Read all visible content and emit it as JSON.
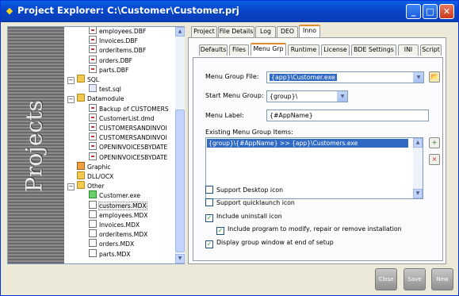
{
  "window": {
    "title": "Project Explorer: C:\\Customer\\Customer.prj",
    "minimize": "_",
    "maximize": "□",
    "close": "✕"
  },
  "banner": {
    "text": "Projects"
  },
  "tree": [
    {
      "label": "employees.DBF",
      "icon": "dbf-file-icon",
      "indent": 2
    },
    {
      "label": "Invoices.DBF",
      "icon": "dbf-file-icon",
      "indent": 2
    },
    {
      "label": "orderitems.DBF",
      "icon": "dbf-file-icon",
      "indent": 2
    },
    {
      "label": "orders.DBF",
      "icon": "dbf-file-icon",
      "indent": 2
    },
    {
      "label": "parts.DBF",
      "icon": "dbf-file-icon",
      "indent": 2
    },
    {
      "label": "SQL",
      "icon": "folder-icon",
      "indent": 1,
      "expander": "−"
    },
    {
      "label": "test.sql",
      "icon": "sql-file-icon",
      "indent": 2
    },
    {
      "label": "Datamodule",
      "icon": "folder-icon",
      "indent": 1,
      "expander": "−"
    },
    {
      "label": "Backup of CUSTOMERS",
      "icon": "datamodule-file-icon",
      "indent": 2
    },
    {
      "label": "CustomerList.dmd",
      "icon": "datamodule-file-icon",
      "indent": 2
    },
    {
      "label": "CUSTOMERSANDINVOI",
      "icon": "datamodule-file-icon",
      "indent": 2
    },
    {
      "label": "CUSTOMERSANDINVOI",
      "icon": "datamodule-file-icon",
      "indent": 2
    },
    {
      "label": "OPENINVOICESBYDATE",
      "icon": "datamodule-file-icon",
      "indent": 2
    },
    {
      "label": "OPENINVOICESBYDATE",
      "icon": "datamodule-file-icon",
      "indent": 2
    },
    {
      "label": "Graphic",
      "icon": "graphic-folder-icon",
      "indent": 1
    },
    {
      "label": "DLL/OCX",
      "icon": "folder-icon",
      "indent": 1
    },
    {
      "label": "Other",
      "icon": "folder-icon",
      "indent": 1,
      "expander": "−"
    },
    {
      "label": "Customer.exe",
      "icon": "exe-file-icon",
      "indent": 2
    },
    {
      "label": "customers.MDX",
      "icon": "mdx-file-icon",
      "indent": 2,
      "selected": true
    },
    {
      "label": "employees.MDX",
      "icon": "mdx-file-icon",
      "indent": 2
    },
    {
      "label": "Invoices.MDX",
      "icon": "mdx-file-icon",
      "indent": 2
    },
    {
      "label": "orderitems.MDX",
      "icon": "mdx-file-icon",
      "indent": 2
    },
    {
      "label": "orders.MDX",
      "icon": "mdx-file-icon",
      "indent": 2
    },
    {
      "label": "parts.MDX",
      "icon": "mdx-file-icon",
      "indent": 2
    }
  ],
  "top_tabs": [
    {
      "label": "Project"
    },
    {
      "label": "File Details"
    },
    {
      "label": "Log"
    },
    {
      "label": "DEO"
    },
    {
      "label": "Inno",
      "active": true
    }
  ],
  "sub_tabs": [
    {
      "label": "Defaults"
    },
    {
      "label": "Files"
    },
    {
      "label": "Menu Grp",
      "active": true
    },
    {
      "label": "Runtime"
    },
    {
      "label": "License"
    },
    {
      "label": "BDE Settings"
    },
    {
      "label": "INI"
    },
    {
      "label": "Script"
    }
  ],
  "form": {
    "menu_group_file_label": "Menu Group File:",
    "menu_group_file_value": "{app}\\Customer.exe",
    "start_menu_group_label": "Start Menu Group:",
    "start_menu_group_value": "{group}\\",
    "menu_label_label": "Menu Label:",
    "menu_label_value": "{#AppName}",
    "existing_items_label": "Existing Menu Group Items:",
    "existing_items": [
      "{group}\\{#AppName} >> {app}\\Customers.exe"
    ]
  },
  "checkboxes": [
    {
      "label": "Support Desktop icon",
      "checked": false
    },
    {
      "label": "Support quicklaunch icon",
      "checked": false
    },
    {
      "label": "Include uninstall icon",
      "checked": true
    },
    {
      "label": "Include program to modify, repair or remove installation",
      "checked": true
    },
    {
      "label": "Display group window at end of setup",
      "checked": true
    }
  ],
  "buttons": {
    "close": "Close",
    "save": "Save",
    "new": "New"
  },
  "colors": {
    "titlebar": "#0846c8",
    "selection": "#316ac5",
    "check": "#21a121"
  }
}
